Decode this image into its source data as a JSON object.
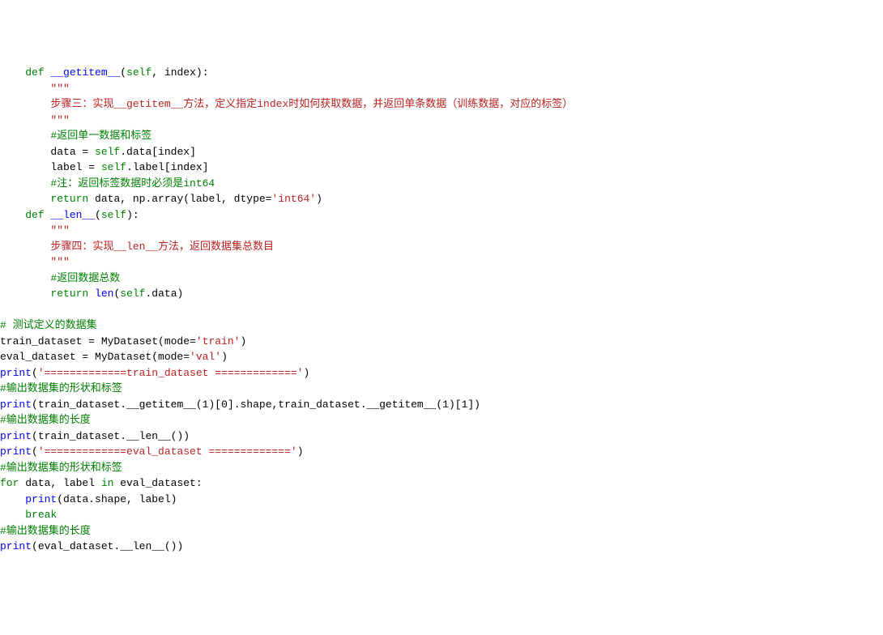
{
  "lines": [
    {
      "indent": 1,
      "parts": [
        {
          "cls": "tok-kw",
          "t": "def"
        },
        {
          "cls": "",
          "t": " "
        },
        {
          "cls": "tok-def",
          "t": "__getitem__"
        },
        {
          "cls": "",
          "t": "("
        },
        {
          "cls": "tok-kw",
          "t": "self"
        },
        {
          "cls": "",
          "t": ", index):"
        }
      ]
    },
    {
      "indent": 2,
      "parts": [
        {
          "cls": "tok-docstr",
          "t": "\"\"\""
        }
      ]
    },
    {
      "indent": 2,
      "parts": [
        {
          "cls": "tok-dark-red",
          "t": "步骤三：实现__getitem__方法，定义指定index时如何获取数据，并返回单条数据（训练数据，对应的标签）"
        }
      ]
    },
    {
      "indent": 2,
      "parts": [
        {
          "cls": "tok-docstr",
          "t": "\"\"\""
        }
      ]
    },
    {
      "indent": 2,
      "parts": [
        {
          "cls": "tok-green-comment",
          "t": "#返回单一数据和标签"
        }
      ]
    },
    {
      "indent": 2,
      "parts": [
        {
          "cls": "",
          "t": "data = "
        },
        {
          "cls": "tok-kw",
          "t": "self"
        },
        {
          "cls": "",
          "t": ".data[index]"
        }
      ]
    },
    {
      "indent": 2,
      "parts": [
        {
          "cls": "",
          "t": "label = "
        },
        {
          "cls": "tok-kw",
          "t": "self"
        },
        {
          "cls": "",
          "t": ".label[index]"
        }
      ]
    },
    {
      "indent": 2,
      "parts": [
        {
          "cls": "tok-green-comment",
          "t": "#注：返回标签数据时必须是int64"
        }
      ]
    },
    {
      "indent": 2,
      "parts": [
        {
          "cls": "tok-kw",
          "t": "return"
        },
        {
          "cls": "",
          "t": " data, np.array(label, dtype="
        },
        {
          "cls": "tok-str",
          "t": "'int64'"
        },
        {
          "cls": "",
          "t": ")"
        }
      ]
    },
    {
      "indent": 1,
      "parts": [
        {
          "cls": "tok-kw",
          "t": "def"
        },
        {
          "cls": "",
          "t": " "
        },
        {
          "cls": "tok-def",
          "t": "__len__"
        },
        {
          "cls": "",
          "t": "("
        },
        {
          "cls": "tok-kw",
          "t": "self"
        },
        {
          "cls": "",
          "t": "):"
        }
      ]
    },
    {
      "indent": 2,
      "parts": [
        {
          "cls": "tok-docstr",
          "t": "\"\"\""
        }
      ]
    },
    {
      "indent": 2,
      "parts": [
        {
          "cls": "tok-dark-red",
          "t": "步骤四：实现__len__方法，返回数据集总数目"
        }
      ]
    },
    {
      "indent": 2,
      "parts": [
        {
          "cls": "tok-docstr",
          "t": "\"\"\""
        }
      ]
    },
    {
      "indent": 2,
      "parts": [
        {
          "cls": "tok-green-comment",
          "t": "#返回数据总数"
        }
      ]
    },
    {
      "indent": 2,
      "parts": [
        {
          "cls": "tok-kw",
          "t": "return"
        },
        {
          "cls": "",
          "t": " "
        },
        {
          "cls": "tok-builtin",
          "t": "len"
        },
        {
          "cls": "",
          "t": "("
        },
        {
          "cls": "tok-kw",
          "t": "self"
        },
        {
          "cls": "",
          "t": ".data)"
        }
      ]
    },
    {
      "indent": 0,
      "parts": [
        {
          "cls": "",
          "t": " "
        }
      ]
    },
    {
      "indent": 0,
      "parts": [
        {
          "cls": "tok-green-comment",
          "t": "# 测试定义的数据集"
        }
      ]
    },
    {
      "indent": 0,
      "parts": [
        {
          "cls": "",
          "t": "train_dataset = MyDataset(mode="
        },
        {
          "cls": "tok-str",
          "t": "'train'"
        },
        {
          "cls": "",
          "t": ")"
        }
      ]
    },
    {
      "indent": 0,
      "parts": [
        {
          "cls": "",
          "t": "eval_dataset = MyDataset(mode="
        },
        {
          "cls": "tok-str",
          "t": "'val'"
        },
        {
          "cls": "",
          "t": ")"
        }
      ]
    },
    {
      "indent": 0,
      "parts": [
        {
          "cls": "tok-builtin",
          "t": "print"
        },
        {
          "cls": "",
          "t": "("
        },
        {
          "cls": "tok-str",
          "t": "'=============train_dataset ============='"
        },
        {
          "cls": "",
          "t": ")"
        }
      ]
    },
    {
      "indent": 0,
      "parts": [
        {
          "cls": "tok-green-comment",
          "t": "#输出数据集的形状和标签"
        }
      ]
    },
    {
      "indent": 0,
      "parts": [
        {
          "cls": "tok-builtin",
          "t": "print"
        },
        {
          "cls": "",
          "t": "(train_dataset.__getitem__("
        },
        {
          "cls": "tok-num",
          "t": "1"
        },
        {
          "cls": "",
          "t": ")["
        },
        {
          "cls": "tok-num",
          "t": "0"
        },
        {
          "cls": "",
          "t": "].shape,train_dataset.__getitem__("
        },
        {
          "cls": "tok-num",
          "t": "1"
        },
        {
          "cls": "",
          "t": ")["
        },
        {
          "cls": "tok-num",
          "t": "1"
        },
        {
          "cls": "",
          "t": "])"
        }
      ]
    },
    {
      "indent": 0,
      "parts": [
        {
          "cls": "tok-green-comment",
          "t": "#输出数据集的长度"
        }
      ]
    },
    {
      "indent": 0,
      "parts": [
        {
          "cls": "tok-builtin",
          "t": "print"
        },
        {
          "cls": "",
          "t": "(train_dataset.__len__())"
        }
      ]
    },
    {
      "indent": 0,
      "parts": [
        {
          "cls": "tok-builtin",
          "t": "print"
        },
        {
          "cls": "",
          "t": "("
        },
        {
          "cls": "tok-str",
          "t": "'=============eval_dataset ============='"
        },
        {
          "cls": "",
          "t": ")"
        }
      ]
    },
    {
      "indent": 0,
      "parts": [
        {
          "cls": "tok-green-comment",
          "t": "#输出数据集的形状和标签"
        }
      ]
    },
    {
      "indent": 0,
      "parts": [
        {
          "cls": "tok-kw",
          "t": "for"
        },
        {
          "cls": "",
          "t": " data, label "
        },
        {
          "cls": "tok-kw",
          "t": "in"
        },
        {
          "cls": "",
          "t": " eval_dataset:"
        }
      ]
    },
    {
      "indent": 1,
      "parts": [
        {
          "cls": "tok-builtin",
          "t": "print"
        },
        {
          "cls": "",
          "t": "(data.shape, label)"
        }
      ]
    },
    {
      "indent": 1,
      "parts": [
        {
          "cls": "tok-kw",
          "t": "break"
        }
      ]
    },
    {
      "indent": 0,
      "parts": [
        {
          "cls": "tok-green-comment",
          "t": "#输出数据集的长度"
        }
      ]
    },
    {
      "indent": 0,
      "parts": [
        {
          "cls": "tok-builtin",
          "t": "print"
        },
        {
          "cls": "",
          "t": "(eval_dataset.__len__())"
        }
      ]
    }
  ],
  "indent_unit": "    "
}
